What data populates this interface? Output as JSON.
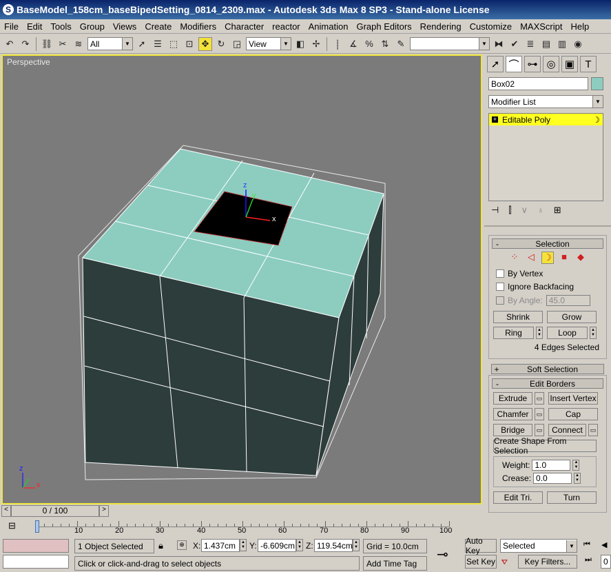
{
  "window": {
    "title": "BaseModel_158cm_baseBipedSetting_0814_2309.max - Autodesk 3ds Max 8 SP3  - Stand-alone License"
  },
  "menu": [
    "File",
    "Edit",
    "Tools",
    "Group",
    "Views",
    "Create",
    "Modifiers",
    "Character",
    "reactor",
    "Animation",
    "Graph Editors",
    "Rendering",
    "Customize",
    "MAXScript",
    "Help"
  ],
  "toolbar": {
    "selection_filter": "All",
    "ref_coord": "View",
    "named_sel": ""
  },
  "viewport": {
    "label": "Perspective",
    "gizmo_x": "x",
    "gizmo_y": "y",
    "gizmo_z": "z",
    "axis_x": "x",
    "axis_z": "z"
  },
  "panel": {
    "object_name": "Box02",
    "modifier_list": "Modifier List",
    "stack_item": "Editable Poly",
    "selection": {
      "title": "Selection",
      "by_vertex": "By Vertex",
      "ignore_backfacing": "Ignore Backfacing",
      "by_angle": "By Angle:",
      "by_angle_value": "45.0",
      "shrink": "Shrink",
      "grow": "Grow",
      "ring": "Ring",
      "loop": "Loop",
      "status": "4 Edges Selected"
    },
    "soft_selection": "Soft Selection",
    "edit_borders": {
      "title": "Edit Borders",
      "extrude": "Extrude",
      "insert_vertex": "Insert Vertex",
      "chamfer": "Chamfer",
      "cap": "Cap",
      "bridge": "Bridge",
      "connect": "Connect",
      "create_shape": "Create Shape From Selection",
      "weight_label": "Weight:",
      "weight_value": "1.0",
      "crease_label": "Crease:",
      "crease_value": "0.0",
      "edit_tri": "Edit Tri.",
      "turn": "Turn"
    }
  },
  "timeline": {
    "frame": "0 / 100",
    "ticks": [
      "0",
      "10",
      "20",
      "30",
      "40",
      "50",
      "60",
      "70",
      "80",
      "90",
      "100"
    ]
  },
  "status": {
    "objects": "1 Object Selected",
    "prompt": "Click or click-and-drag to select objects",
    "x_label": "X:",
    "x": "1.437cm",
    "y_label": "Y:",
    "y": "-6.609cm",
    "z_label": "Z:",
    "z": "119.54cm",
    "grid": "Grid = 10.0cm",
    "add_time_tag": "Add Time Tag",
    "auto_key": "Auto Key",
    "set_key": "Set Key",
    "key_mode": "Selected",
    "key_filters": "Key Filters...",
    "frame_field": "0"
  }
}
